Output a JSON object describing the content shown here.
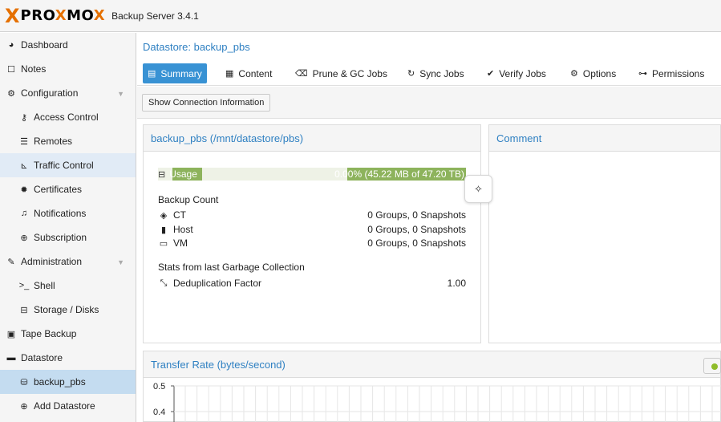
{
  "header": {
    "logo_x": "X",
    "logo_pro": "PRO",
    "logo_x2": "X",
    "logo_mo": "MO",
    "logo_x3": "X",
    "product": "Backup Server 3.4.1"
  },
  "sidebar": {
    "items": [
      {
        "label": "Dashboard",
        "icon": "dashboard-icon"
      },
      {
        "label": "Notes",
        "icon": "notes-icon"
      },
      {
        "label": "Configuration",
        "icon": "cogs-icon"
      },
      {
        "label": "Access Control",
        "icon": "key-icon"
      },
      {
        "label": "Remotes",
        "icon": "server-icon"
      },
      {
        "label": "Traffic Control",
        "icon": "traffic-icon"
      },
      {
        "label": "Certificates",
        "icon": "certificate-icon"
      },
      {
        "label": "Notifications",
        "icon": "bell-icon"
      },
      {
        "label": "Subscription",
        "icon": "support-icon"
      },
      {
        "label": "Administration",
        "icon": "wrench-icon"
      },
      {
        "label": "Shell",
        "icon": "terminal-icon"
      },
      {
        "label": "Storage / Disks",
        "icon": "hdd-icon"
      },
      {
        "label": "Tape Backup",
        "icon": "tape-icon"
      },
      {
        "label": "Datastore",
        "icon": "archive-icon"
      },
      {
        "label": "backup_pbs",
        "icon": "database-icon"
      },
      {
        "label": "Add Datastore",
        "icon": "plus-circle-icon"
      }
    ]
  },
  "main": {
    "title": "Datastore: backup_pbs",
    "tabs": [
      {
        "label": "Summary",
        "icon": "book-icon"
      },
      {
        "label": "Content",
        "icon": "th-icon"
      },
      {
        "label": "Prune & GC Jobs",
        "icon": "trash-icon"
      },
      {
        "label": "Sync Jobs",
        "icon": "refresh-icon"
      },
      {
        "label": "Verify Jobs",
        "icon": "check-circle-icon"
      },
      {
        "label": "Options",
        "icon": "gear-icon"
      },
      {
        "label": "Permissions",
        "icon": "unlock-icon"
      }
    ],
    "connection_button": "Show Connection Information"
  },
  "datastore_panel": {
    "title": "backup_pbs (/mnt/datastore/pbs)",
    "usage_label": "Usage",
    "usage_value": "0.00% (45.22 MB of 47.20 TB)",
    "usage_fraction": 0.0,
    "backup_count_label": "Backup Count",
    "rows": [
      {
        "label": "CT",
        "value": "0 Groups, 0 Snapshots",
        "icon": "cube-icon"
      },
      {
        "label": "Host",
        "value": "0 Groups, 0 Snapshots",
        "icon": "building-icon"
      },
      {
        "label": "VM",
        "value": "0 Groups, 0 Snapshots",
        "icon": "desktop-icon"
      }
    ],
    "gc_label": "Stats from last Garbage Collection",
    "dedup_label": "Deduplication Factor",
    "dedup_value": "1.00"
  },
  "comment_panel": {
    "title": "Comment"
  },
  "transfer_panel": {
    "title": "Transfer Rate (bytes/second)",
    "y_ticks": [
      "0.5",
      "0.4"
    ]
  },
  "chart_data": {
    "type": "line",
    "title": "Transfer Rate (bytes/second)",
    "ylim": [
      0,
      0.5
    ],
    "y_ticks": [
      0.5,
      0.4
    ],
    "series": [],
    "grid": true
  }
}
